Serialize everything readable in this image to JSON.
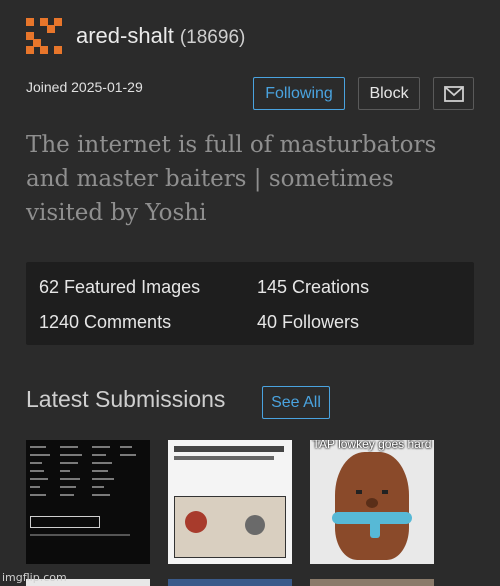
{
  "profile": {
    "username": "ared-shalt",
    "score": "(18696)",
    "joined": "Joined 2025-01-29",
    "bio": "The internet is full of masturbators and master baiters | sometimes visited by Yoshi"
  },
  "actions": {
    "following_label": "Following",
    "block_label": "Block",
    "message_icon": "envelope-icon"
  },
  "stats": {
    "featured_images": "62 Featured Images",
    "creations": "145 Creations",
    "comments": "1240 Comments",
    "followers": "40 Followers"
  },
  "latest": {
    "title": "Latest Submissions",
    "see_all_label": "See All",
    "thumb3_caption": "TAP lowkey goes hard"
  },
  "watermark": "imgflip.com",
  "colors": {
    "background": "#2b2b2b",
    "accent": "#4aa3df",
    "logo": "#e8762b",
    "stats_panel": "#1e1e1e"
  }
}
